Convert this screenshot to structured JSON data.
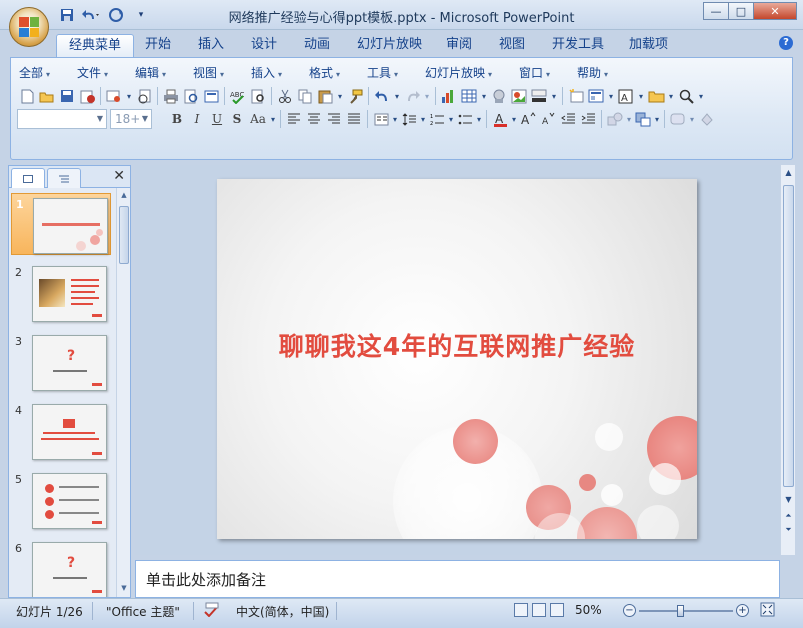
{
  "window": {
    "title": "网络推广经验与心得ppt模板.pptx - Microsoft PowerPoint",
    "caption_min": "—",
    "caption_max": "□",
    "caption_close": "✕"
  },
  "qat": {
    "save_icon": "save-icon",
    "undo_icon": "undo-icon",
    "redo_icon": "redo-icon",
    "customize_icon": "chevron-down-icon"
  },
  "tabs": [
    {
      "label": "经典菜单",
      "active": true
    },
    {
      "label": "开始"
    },
    {
      "label": "插入"
    },
    {
      "label": "设计"
    },
    {
      "label": "动画"
    },
    {
      "label": "幻灯片放映"
    },
    {
      "label": "审阅"
    },
    {
      "label": "视图"
    },
    {
      "label": "开发工具"
    },
    {
      "label": "加载项"
    }
  ],
  "help": "?",
  "menubar": [
    {
      "label": "全部"
    },
    {
      "label": "文件"
    },
    {
      "label": "编辑"
    },
    {
      "label": "视图"
    },
    {
      "label": "插入"
    },
    {
      "label": "格式"
    },
    {
      "label": "工具"
    },
    {
      "label": "幻灯片放映"
    },
    {
      "label": "窗口"
    },
    {
      "label": "帮助"
    }
  ],
  "formatting": {
    "font_name": "",
    "font_size": "18+",
    "bold": "B",
    "italic": "I",
    "underline": "U",
    "strike": "S",
    "case": "Aa"
  },
  "slides_pane": {
    "close": "✕",
    "slides": [
      {
        "num": "1",
        "selected": true
      },
      {
        "num": "2"
      },
      {
        "num": "3"
      },
      {
        "num": "4"
      },
      {
        "num": "5"
      },
      {
        "num": "6"
      }
    ]
  },
  "slide": {
    "title": "聊聊我这4年的互联网推广经验",
    "accent_color": "#e24c3f"
  },
  "notes": {
    "placeholder": "单击此处添加备注"
  },
  "status": {
    "slide_counter": "幻灯片 1/26",
    "theme": "\"Office 主题\"",
    "language": "中文(简体，中国)",
    "zoom": "50%",
    "zoom_value": 0.5
  }
}
